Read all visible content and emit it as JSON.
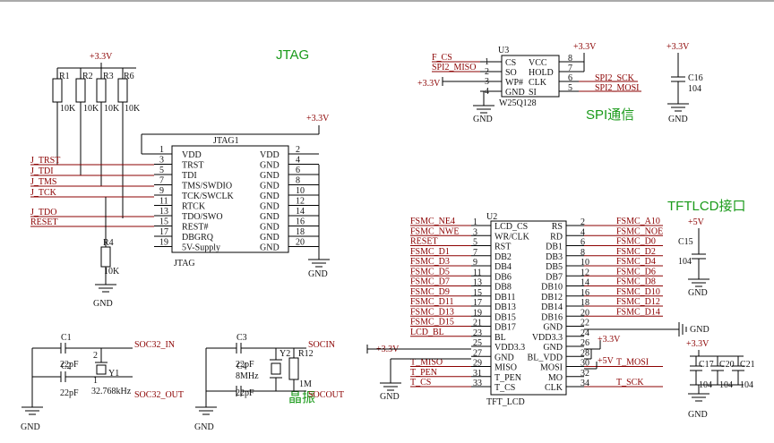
{
  "sections": {
    "jtag": "JTAG",
    "spi": "SPI通信",
    "tft": "TFTLCD接口",
    "crystal": "晶振"
  },
  "power": {
    "p33": "+3.3V",
    "p5": "+5V",
    "gnd": "GND"
  },
  "jtag": {
    "ref": "JTAG1",
    "name": "JTAG",
    "pins_left": [
      {
        "num": "1",
        "name": "VDD"
      },
      {
        "num": "3",
        "name": "TRST"
      },
      {
        "num": "5",
        "name": "TDI"
      },
      {
        "num": "7",
        "name": "TMS/SWDIO"
      },
      {
        "num": "9",
        "name": "TCK/SWCLK"
      },
      {
        "num": "11",
        "name": "RTCK"
      },
      {
        "num": "13",
        "name": "TDO/SWO"
      },
      {
        "num": "15",
        "name": "REST#"
      },
      {
        "num": "17",
        "name": "DBGRQ"
      },
      {
        "num": "19",
        "name": "5V-Supply"
      }
    ],
    "pins_right": [
      {
        "num": "2",
        "name": "VDD"
      },
      {
        "num": "4",
        "name": "GND"
      },
      {
        "num": "6",
        "name": "GND"
      },
      {
        "num": "8",
        "name": "GND"
      },
      {
        "num": "10",
        "name": "GND"
      },
      {
        "num": "12",
        "name": "GND"
      },
      {
        "num": "14",
        "name": "GND"
      },
      {
        "num": "16",
        "name": "GND"
      },
      {
        "num": "18",
        "name": "GND"
      },
      {
        "num": "20",
        "name": "GND"
      }
    ],
    "nets": [
      "J_TRST",
      "J_TDI",
      "J_TMS",
      "J_TCK",
      "J_TDO",
      "RESET"
    ],
    "resistors": [
      {
        "ref": "R1",
        "value": "10K"
      },
      {
        "ref": "R2",
        "value": "10K"
      },
      {
        "ref": "R3",
        "value": "10K"
      },
      {
        "ref": "R6",
        "value": "10K"
      }
    ],
    "r4": {
      "ref": "R4",
      "value": "10K"
    }
  },
  "spi": {
    "ref": "U3",
    "part": "W25Q128",
    "nets": [
      "F_CS",
      "SPI2_MISO",
      "SPI2_SCK",
      "SPI2_MOSI"
    ],
    "pins_left": [
      {
        "num": "1",
        "name": "CS"
      },
      {
        "num": "2",
        "name": "SO"
      },
      {
        "num": "3",
        "name": "WP#"
      },
      {
        "num": "4",
        "name": "GND"
      }
    ],
    "pins_right": [
      {
        "num": "8",
        "name": "VCC"
      },
      {
        "num": "7",
        "name": "HOLD"
      },
      {
        "num": "6",
        "name": "CLK"
      },
      {
        "num": "5",
        "name": "SI"
      }
    ],
    "cap": {
      "ref": "C16",
      "value": "104"
    }
  },
  "tft": {
    "ref": "U2",
    "part": "TFT_LCD",
    "pins": [
      {
        "ln": "1",
        "ls": "LCD_CS",
        "rs": "RS",
        "rn": "2",
        "lnet": "FSMC_NE4",
        "rnet": "FSMC_A10"
      },
      {
        "ln": "3",
        "ls": "WR/CLK",
        "rs": "RD",
        "rn": "4",
        "lnet": "FSMC_NWE",
        "rnet": "FSMC_NOE"
      },
      {
        "ln": "5",
        "ls": "RST",
        "rs": "DB1",
        "rn": "6",
        "lnet": "RESET",
        "rnet": "FSMC_D0"
      },
      {
        "ln": "7",
        "ls": "DB2",
        "rs": "DB3",
        "rn": "8",
        "lnet": "FSMC_D1",
        "rnet": "FSMC_D2"
      },
      {
        "ln": "9",
        "ls": "DB4",
        "rs": "DB5",
        "rn": "10",
        "lnet": "FSMC_D3",
        "rnet": "FSMC_D4"
      },
      {
        "ln": "11",
        "ls": "DB6",
        "rs": "DB7",
        "rn": "12",
        "lnet": "FSMC_D5",
        "rnet": "FSMC_D6"
      },
      {
        "ln": "13",
        "ls": "DB8",
        "rs": "DB10",
        "rn": "14",
        "lnet": "FSMC_D7",
        "rnet": "FSMC_D8"
      },
      {
        "ln": "15",
        "ls": "DB11",
        "rs": "DB12",
        "rn": "16",
        "lnet": "FSMC_D9",
        "rnet": "FSMC_D10"
      },
      {
        "ln": "17",
        "ls": "DB13",
        "rs": "DB14",
        "rn": "18",
        "lnet": "FSMC_D11",
        "rnet": "FSMC_D12"
      },
      {
        "ln": "19",
        "ls": "DB15",
        "rs": "DB16",
        "rn": "20",
        "lnet": "FSMC_D13",
        "rnet": "FSMC_D14"
      },
      {
        "ln": "21",
        "ls": "DB17",
        "rs": "GND",
        "rn": "22",
        "lnet": "FSMC_D15",
        "rnet": ""
      },
      {
        "ln": "23",
        "ls": "BL",
        "rs": "VDD3.3",
        "rn": "24",
        "lnet": "LCD_BL",
        "rnet": ""
      },
      {
        "ln": "25",
        "ls": "VDD3.3",
        "rs": "GND",
        "rn": "26",
        "lnet": "",
        "rnet": ""
      },
      {
        "ln": "27",
        "ls": "GND",
        "rs": "BL_VDD",
        "rn": "28",
        "lnet": "",
        "rnet": ""
      },
      {
        "ln": "29",
        "ls": "MISO",
        "rs": "MOSI",
        "rn": "30",
        "lnet": "T_MISO",
        "rnet": "T_MOSI"
      },
      {
        "ln": "31",
        "ls": "T_PEN",
        "rs": "MO",
        "rn": "32",
        "lnet": "T_PEN",
        "rnet": ""
      },
      {
        "ln": "33",
        "ls": "T_CS",
        "rs": "CLK",
        "rn": "34",
        "lnet": "T_CS",
        "rnet": "T_SCK"
      }
    ],
    "c15": {
      "ref": "C15",
      "value": "104"
    },
    "decoupling": [
      {
        "ref": "C17",
        "value": "104"
      },
      {
        "ref": "C20",
        "value": "104"
      },
      {
        "ref": "C21",
        "value": "104"
      }
    ]
  },
  "crystal": {
    "low": {
      "y": "Y1",
      "freq": "32.768kHz",
      "c1": "C1",
      "c2": "C2",
      "cval": "22pF",
      "net_in": "SOC32_IN",
      "net_out": "SOC32_OUT"
    },
    "high": {
      "y": "Y2",
      "freq": "8MHz",
      "c1": "C3",
      "c2": "C4",
      "cval": "22pF",
      "r": "R12",
      "rval": "1M",
      "net_in": "SOCIN",
      "net_out": "SOCOUT"
    }
  }
}
